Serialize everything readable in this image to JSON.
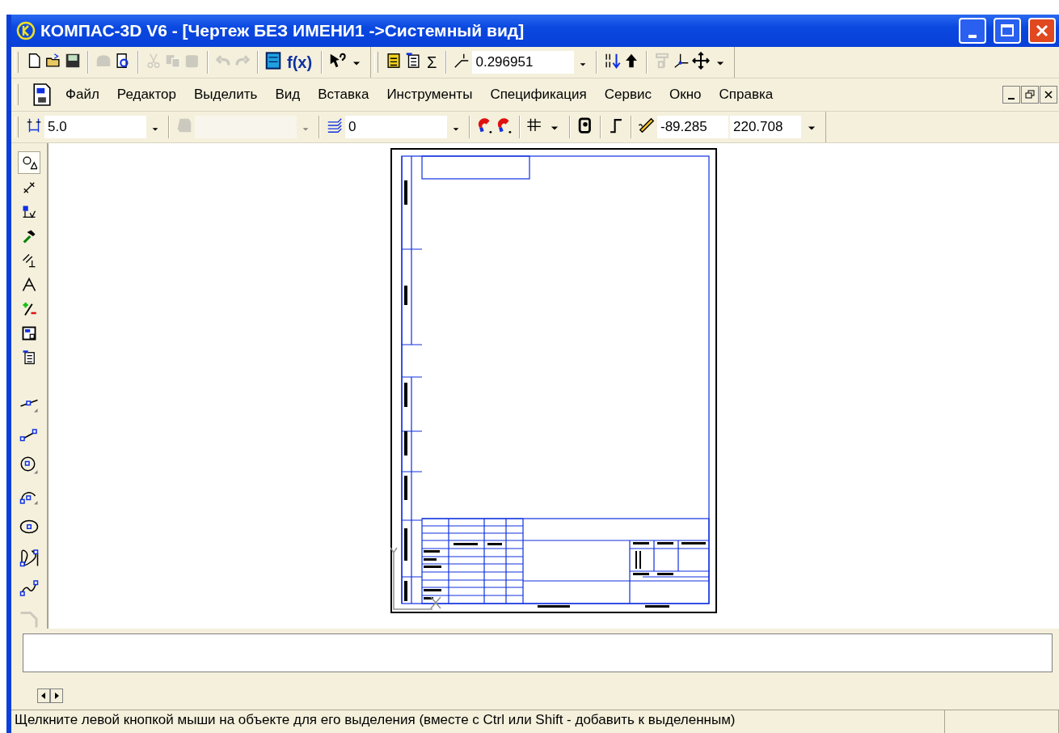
{
  "window": {
    "title": "КОМПАС-3D V6 - [Чертеж БЕЗ ИМЕНИ1 ->Системный вид]"
  },
  "standard_toolbar": [
    [
      {
        "kind": "new",
        "disabled": false
      },
      {
        "kind": "open",
        "disabled": false
      },
      {
        "kind": "save",
        "disabled": false
      }
    ],
    [
      {
        "kind": "print",
        "disabled": true
      },
      {
        "kind": "preview",
        "disabled": false
      }
    ],
    [
      {
        "kind": "cut",
        "disabled": true
      },
      {
        "kind": "copy",
        "disabled": true
      },
      {
        "kind": "paste",
        "disabled": true
      }
    ],
    [
      {
        "kind": "undo",
        "disabled": true
      },
      {
        "kind": "redo",
        "disabled": true
      }
    ],
    [
      {
        "kind": "manager",
        "disabled": false
      },
      {
        "kind": "text",
        "label": "f(x)",
        "disabled": false
      }
    ],
    [
      {
        "kind": "help",
        "disabled": false
      },
      {
        "kind": "caret",
        "disabled": false
      }
    ]
  ],
  "tools_toolbar": [
    [
      {
        "kind": "library",
        "disabled": false
      },
      {
        "kind": "spec",
        "disabled": false
      },
      {
        "kind": "text",
        "label": "Σ",
        "disabled": false
      }
    ],
    [
      {
        "kind": "angle",
        "disabled": false
      },
      {
        "kind": "combo",
        "value": "0.296951",
        "disabled": false
      }
    ],
    [
      {
        "kind": "sort",
        "disabled": false
      },
      {
        "kind": "up",
        "disabled": false
      }
    ],
    [
      {
        "kind": "tower",
        "disabled": true
      },
      {
        "kind": "axes",
        "disabled": false
      },
      {
        "kind": "move",
        "disabled": false
      },
      {
        "kind": "caret",
        "disabled": false
      }
    ]
  ],
  "menu": [
    {
      "label": "Файл"
    },
    {
      "label": "Редактор"
    },
    {
      "label": "Выделить"
    },
    {
      "label": "Вид"
    },
    {
      "label": "Вставка"
    },
    {
      "label": "Инструменты"
    },
    {
      "label": "Спецификация"
    },
    {
      "label": "Сервис"
    },
    {
      "label": "Окно"
    },
    {
      "label": "Справка"
    }
  ],
  "current_toolbar": [
    [
      {
        "kind": "step",
        "disabled": false
      },
      {
        "kind": "combo",
        "value": "5.0",
        "disabled": false
      }
    ],
    [
      {
        "kind": "fill",
        "disabled": true
      },
      {
        "kind": "combo",
        "disabled": true
      }
    ],
    [
      {
        "kind": "layers",
        "disabled": false
      },
      {
        "kind": "combo",
        "value": "0",
        "disabled": false
      }
    ],
    [
      {
        "kind": "magnet",
        "disabled": false
      },
      {
        "kind": "magnet2",
        "disabled": false
      }
    ],
    [
      {
        "kind": "grid",
        "disabled": false
      },
      {
        "kind": "smallcaret",
        "disabled": false
      }
    ],
    [
      {
        "kind": "stamp",
        "disabled": false
      }
    ],
    [
      {
        "kind": "ortho",
        "disabled": false
      }
    ],
    [
      {
        "kind": "pencil",
        "disabled": false
      },
      {
        "kind": "field",
        "value": "-89.285",
        "disabled": false
      },
      {
        "kind": "field",
        "value": "220.708",
        "disabled": false
      },
      {
        "kind": "caret",
        "disabled": false
      }
    ]
  ],
  "compact_panel": [
    {
      "kind": "geometry",
      "selected": true
    },
    {
      "kind": "dimension",
      "selected": false
    },
    {
      "kind": "symbols",
      "selected": false
    },
    {
      "kind": "edit",
      "selected": false
    },
    {
      "kind": "params",
      "selected": false
    },
    {
      "kind": "measure",
      "selected": false
    },
    {
      "kind": "select",
      "selected": false
    },
    {
      "kind": "view",
      "selected": false
    },
    {
      "kind": "spec",
      "selected": false
    }
  ],
  "geometry_tools": [
    {
      "kind": "line",
      "disabled": false
    },
    {
      "kind": "segment",
      "disabled": false
    },
    {
      "kind": "circle",
      "disabled": false
    },
    {
      "kind": "arc",
      "disabled": false
    },
    {
      "kind": "ellipse",
      "disabled": false
    },
    {
      "kind": "spline",
      "disabled": false
    },
    {
      "kind": "polyline",
      "disabled": false
    },
    {
      "kind": "chamfer",
      "disabled": true
    }
  ],
  "status_bar": {
    "text": "Щелкните левой кнопкой мыши на объекте для его выделения (вместе с Ctrl или Shift - добавить к выделенным)"
  }
}
